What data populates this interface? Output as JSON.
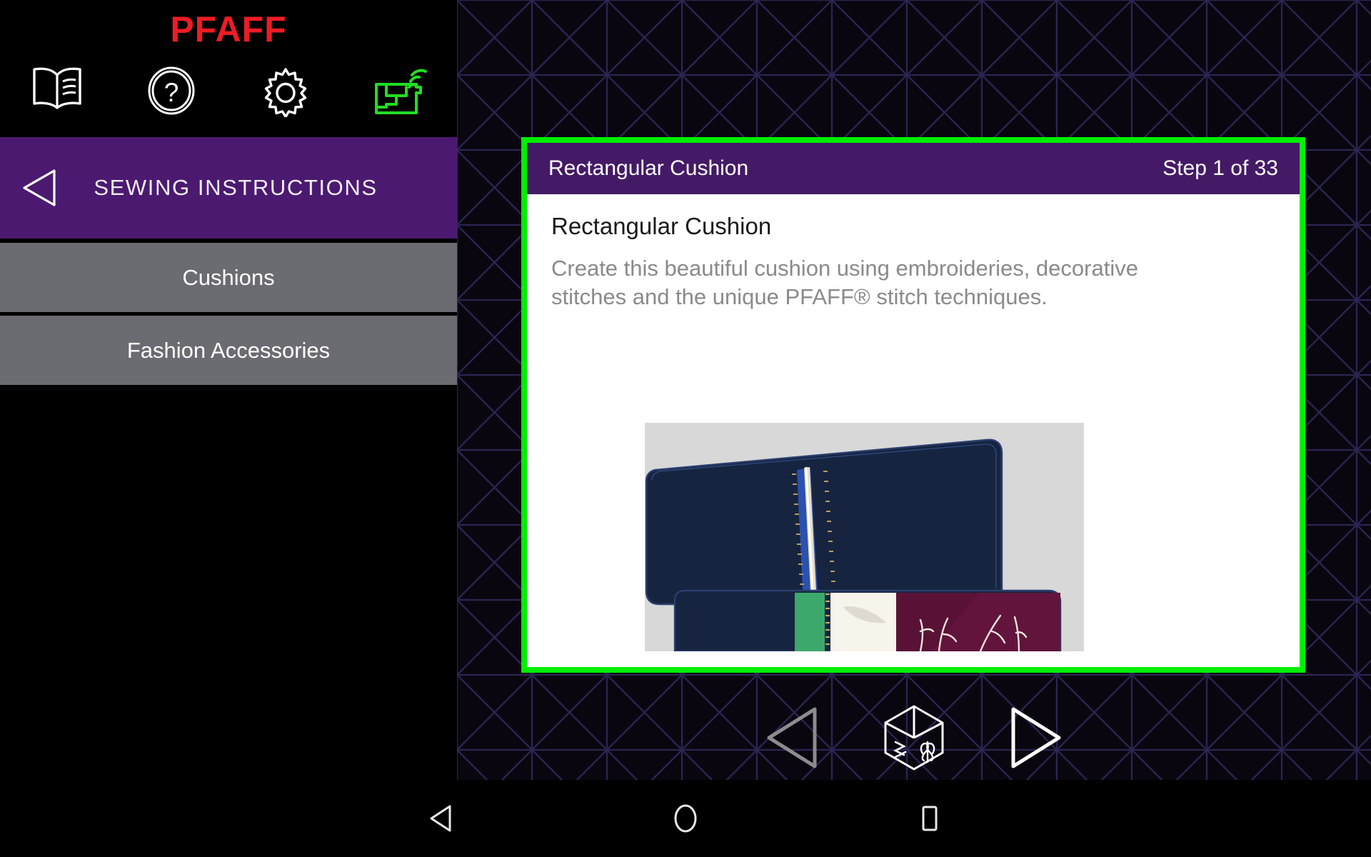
{
  "brand": {
    "logo_text": "PFAFF",
    "logo_color": "#ED1C24"
  },
  "toolbar": {
    "icons": [
      {
        "name": "manual-book-icon",
        "label": "Owner's Manual"
      },
      {
        "name": "help-question-icon",
        "label": "Help"
      },
      {
        "name": "settings-gear-icon",
        "label": "Settings"
      },
      {
        "name": "machine-wifi-icon",
        "label": "Machine WiFi",
        "color": "#22DD22"
      }
    ]
  },
  "sidebar": {
    "header": {
      "title": "SEWING INSTRUCTIONS",
      "back_icon": "back-triangle-icon",
      "background": "#4B1A70"
    },
    "items": [
      {
        "label": "Cushions",
        "selected": true
      },
      {
        "label": "Fashion Accessories",
        "selected": false
      }
    ]
  },
  "card": {
    "border_color": "#00EE00",
    "header": {
      "title": "Rectangular Cushion",
      "step_counter": "Step 1 of 33",
      "background": "#441A66"
    },
    "body": {
      "heading": "Rectangular Cushion",
      "description": "Create this beautiful cushion using embroideries, decorative stitches and the unique PFAFF® stitch techniques."
    },
    "illustration": {
      "alt": "Navy blue rectangular cushions with zipper and embroidered panels",
      "backdrop_color": "#D8D8D8",
      "cushion_color": "#16243F",
      "panel_green": "#3DA86B",
      "panel_cream": "#F7F4EB",
      "panel_burgundy": "#62143C"
    }
  },
  "step_nav": {
    "previous": {
      "name": "previous-step-button",
      "enabled": false
    },
    "stitch_cube": {
      "name": "stitch-cube-button",
      "enabled": true
    },
    "next": {
      "name": "next-step-button",
      "enabled": true
    }
  },
  "system_nav": {
    "back": "android-back-button",
    "home": "android-home-button",
    "recents": "android-recents-button"
  }
}
